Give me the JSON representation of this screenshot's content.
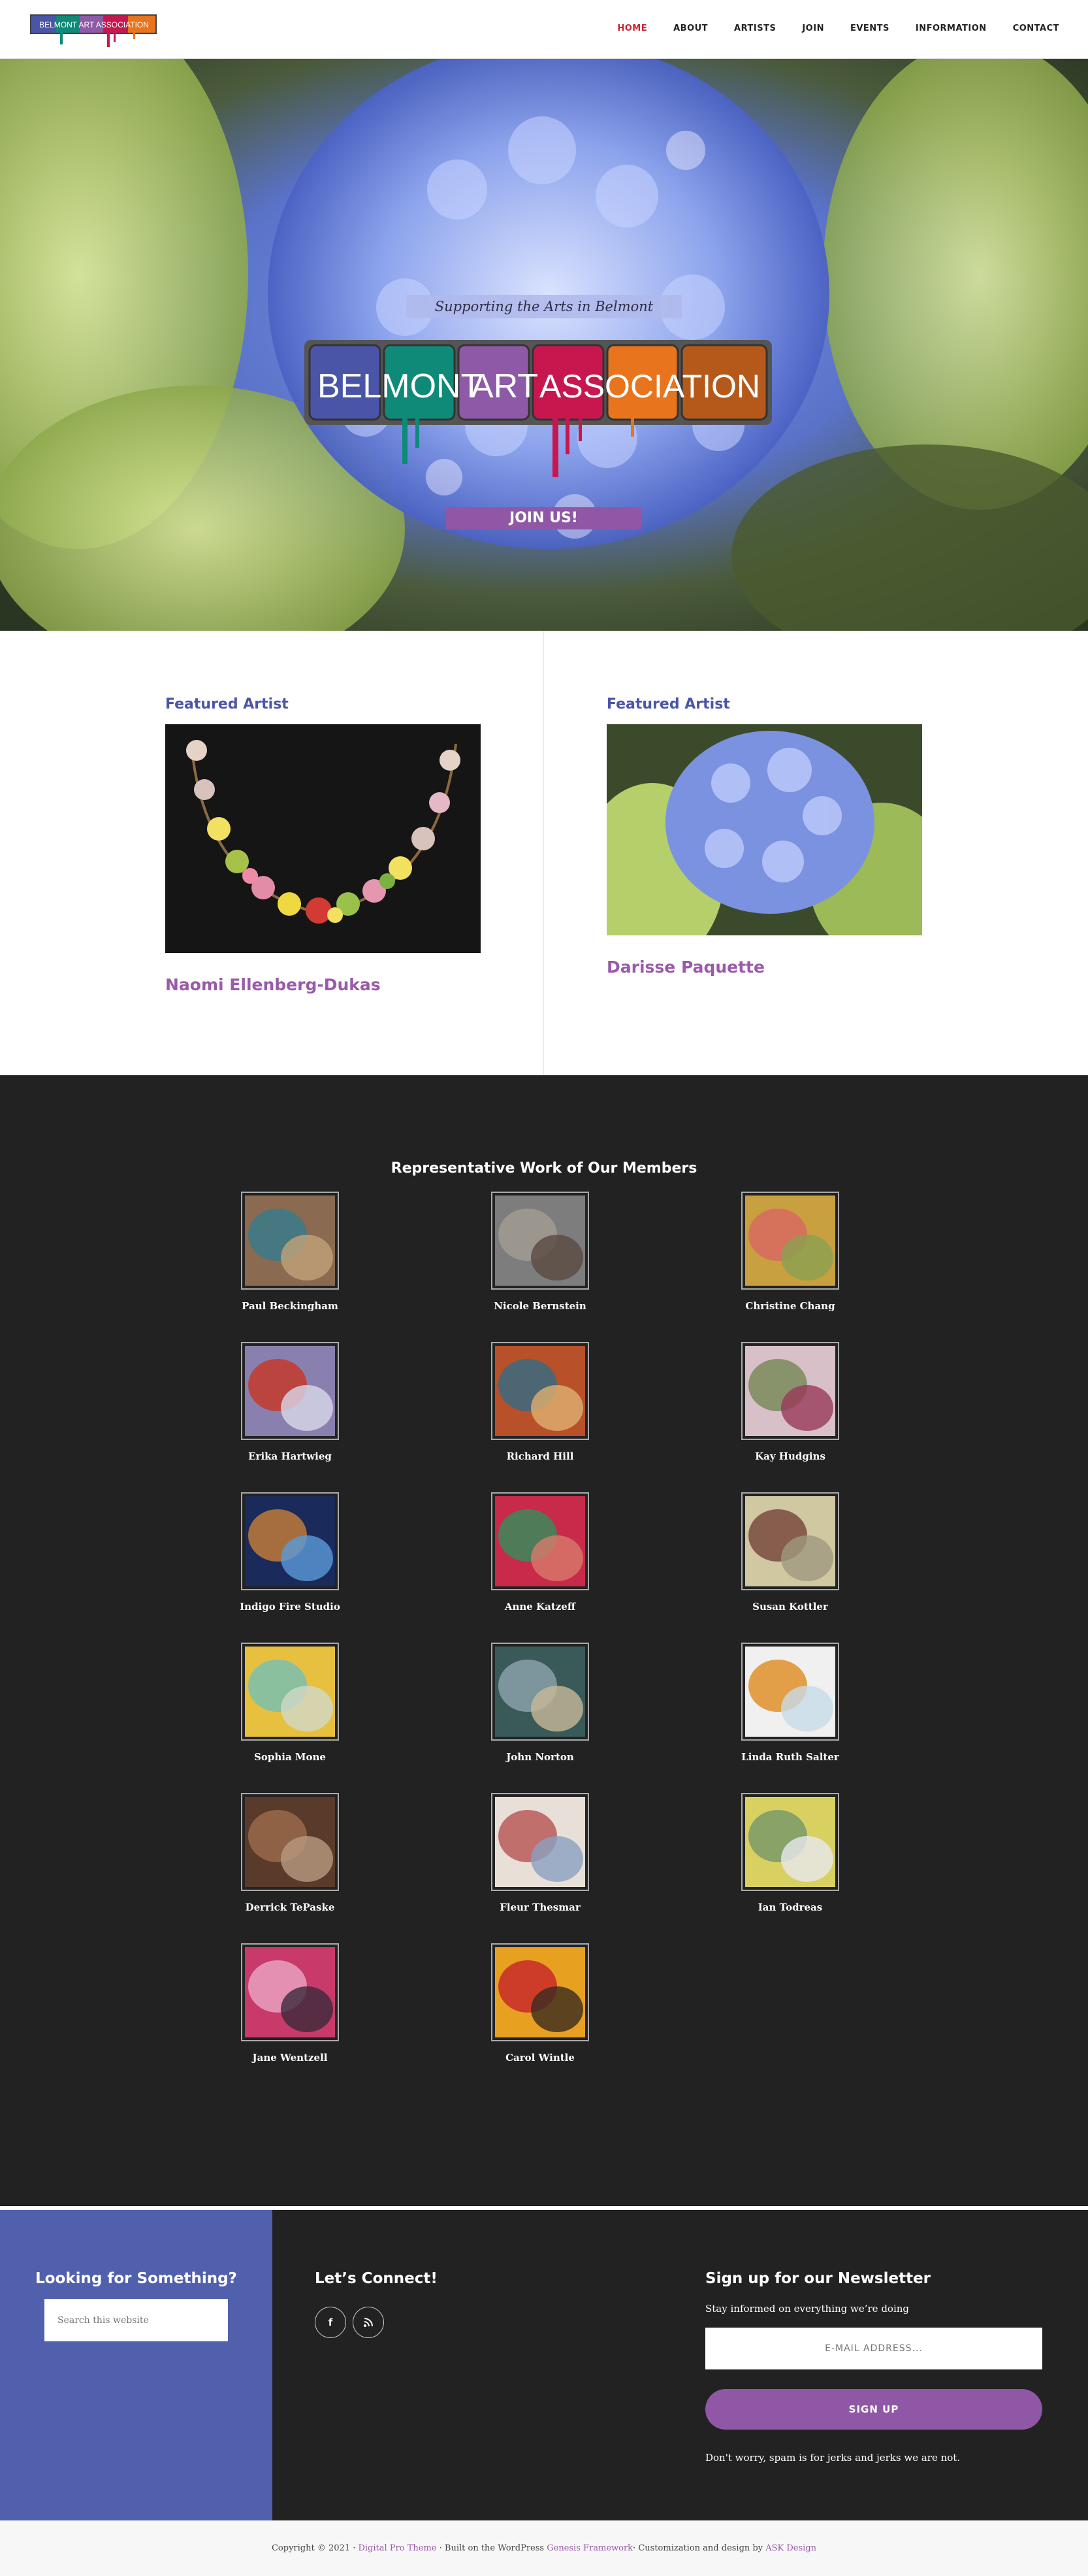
{
  "header": {
    "logo_text": "BELMONT ART ASSOCIATION",
    "nav": [
      "HOME",
      "ABOUT",
      "ARTISTS",
      "JOIN",
      "EVENTS",
      "INFORMATION",
      "CONTACT"
    ],
    "active_nav": "HOME",
    "active_color": "#d0202e"
  },
  "hero": {
    "tagline": "Supporting the Arts in Belmont",
    "logo_words": [
      "BELMONT",
      "ART",
      "ASSOCIATION"
    ],
    "join_label": "JOIN US!",
    "join_color": "#9057a6"
  },
  "featured": {
    "left": {
      "heading": "Featured Artist",
      "name": "Naomi Ellenberg-Dukas",
      "image_icon": "jewelry-necklace-image"
    },
    "right": {
      "heading": "Featured Artist",
      "name": "Darisse Paquette",
      "image_icon": "hydrangea-painting-image"
    }
  },
  "members": {
    "title": "Representative Work of Our Members",
    "artists": [
      {
        "name": "Paul Beckingham"
      },
      {
        "name": "Nicole Bernstein"
      },
      {
        "name": "Christine Chang"
      },
      {
        "name": "Erika Hartwieg"
      },
      {
        "name": "Richard Hill"
      },
      {
        "name": "Kay Hudgins"
      },
      {
        "name": "Indigo Fire Studio"
      },
      {
        "name": "Anne Katzeff"
      },
      {
        "name": "Susan Kottler"
      },
      {
        "name": "Sophia Mone"
      },
      {
        "name": "John Norton"
      },
      {
        "name": "Linda Ruth Salter"
      },
      {
        "name": "Derrick TePaske"
      },
      {
        "name": "Fleur Thesmar"
      },
      {
        "name": "Ian Todreas"
      },
      {
        "name": "Jane Wentzell"
      },
      {
        "name": "Carol Wintle"
      }
    ]
  },
  "footer": {
    "search": {
      "heading": "Looking for Something?",
      "placeholder": "Search this website"
    },
    "connect": {
      "heading": "Let’s Connect!",
      "icons": [
        "facebook-icon",
        "rss-icon"
      ]
    },
    "newsletter": {
      "heading": "Sign up for our Newsletter",
      "text": "Stay informed on everything we’re doing",
      "email_placeholder": "E-MAIL ADDRESS...",
      "button": "SIGN UP",
      "note": "Don't worry, spam is for jerks and jerks we are not."
    },
    "copyright": {
      "prefix": "Copyright © 2021 ·",
      "link1": "Digital Pro Theme",
      "middle": "· Built on the WordPress",
      "link2": "Genesis Framework",
      "middle2": "· Customization and design by",
      "link3": "ASK Design"
    }
  },
  "colors": {
    "brand_blue": "#5060ad",
    "brand_purple": "#9057a6",
    "dark_bg": "#222222"
  }
}
